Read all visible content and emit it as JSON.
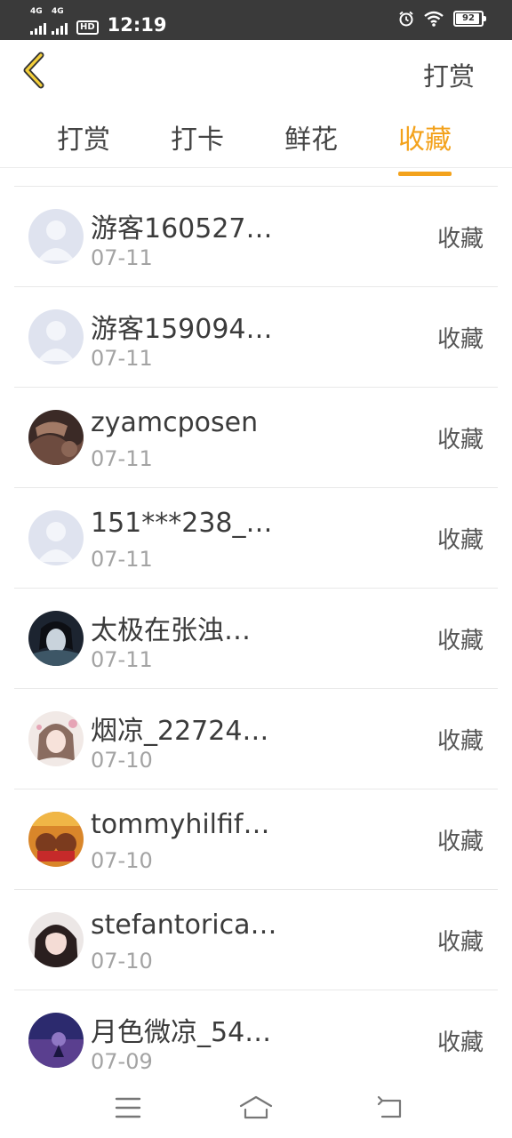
{
  "status_bar": {
    "network_1": "4G",
    "network_2": "4G",
    "hd_label": "HD",
    "time": "12:19",
    "battery": "92"
  },
  "header": {
    "back_icon": "chevron-left-icon",
    "action_label": "打赏"
  },
  "tabs": [
    {
      "label": "打赏",
      "active": false
    },
    {
      "label": "打卡",
      "active": false
    },
    {
      "label": "鲜花",
      "active": false
    },
    {
      "label": "收藏",
      "active": true
    }
  ],
  "accent_color": "#f3a21c",
  "list": [
    {
      "name": "游客160527…",
      "date": "07-11",
      "action": "收藏",
      "avatar": "default-avatar"
    },
    {
      "name": "游客159094…",
      "date": "07-11",
      "action": "收藏",
      "avatar": "default-avatar"
    },
    {
      "name": "zyamcposen",
      "date": "07-11",
      "action": "收藏",
      "avatar": "photo-avatar"
    },
    {
      "name": "151***238_…",
      "date": "07-11",
      "action": "收藏",
      "avatar": "default-avatar"
    },
    {
      "name": "太极在张浊…",
      "date": "07-11",
      "action": "收藏",
      "avatar": "photo-avatar"
    },
    {
      "name": "烟凉_22724…",
      "date": "07-10",
      "action": "收藏",
      "avatar": "photo-avatar"
    },
    {
      "name": "tommyhilfif…",
      "date": "07-10",
      "action": "收藏",
      "avatar": "photo-avatar"
    },
    {
      "name": "stefantorica…",
      "date": "07-10",
      "action": "收藏",
      "avatar": "photo-avatar"
    },
    {
      "name": "月色微凉_54…",
      "date": "07-09",
      "action": "收藏",
      "avatar": "photo-avatar"
    }
  ],
  "navbar": {
    "menu_icon": "menu-icon",
    "home_icon": "home-icon",
    "back_icon": "back-icon"
  }
}
